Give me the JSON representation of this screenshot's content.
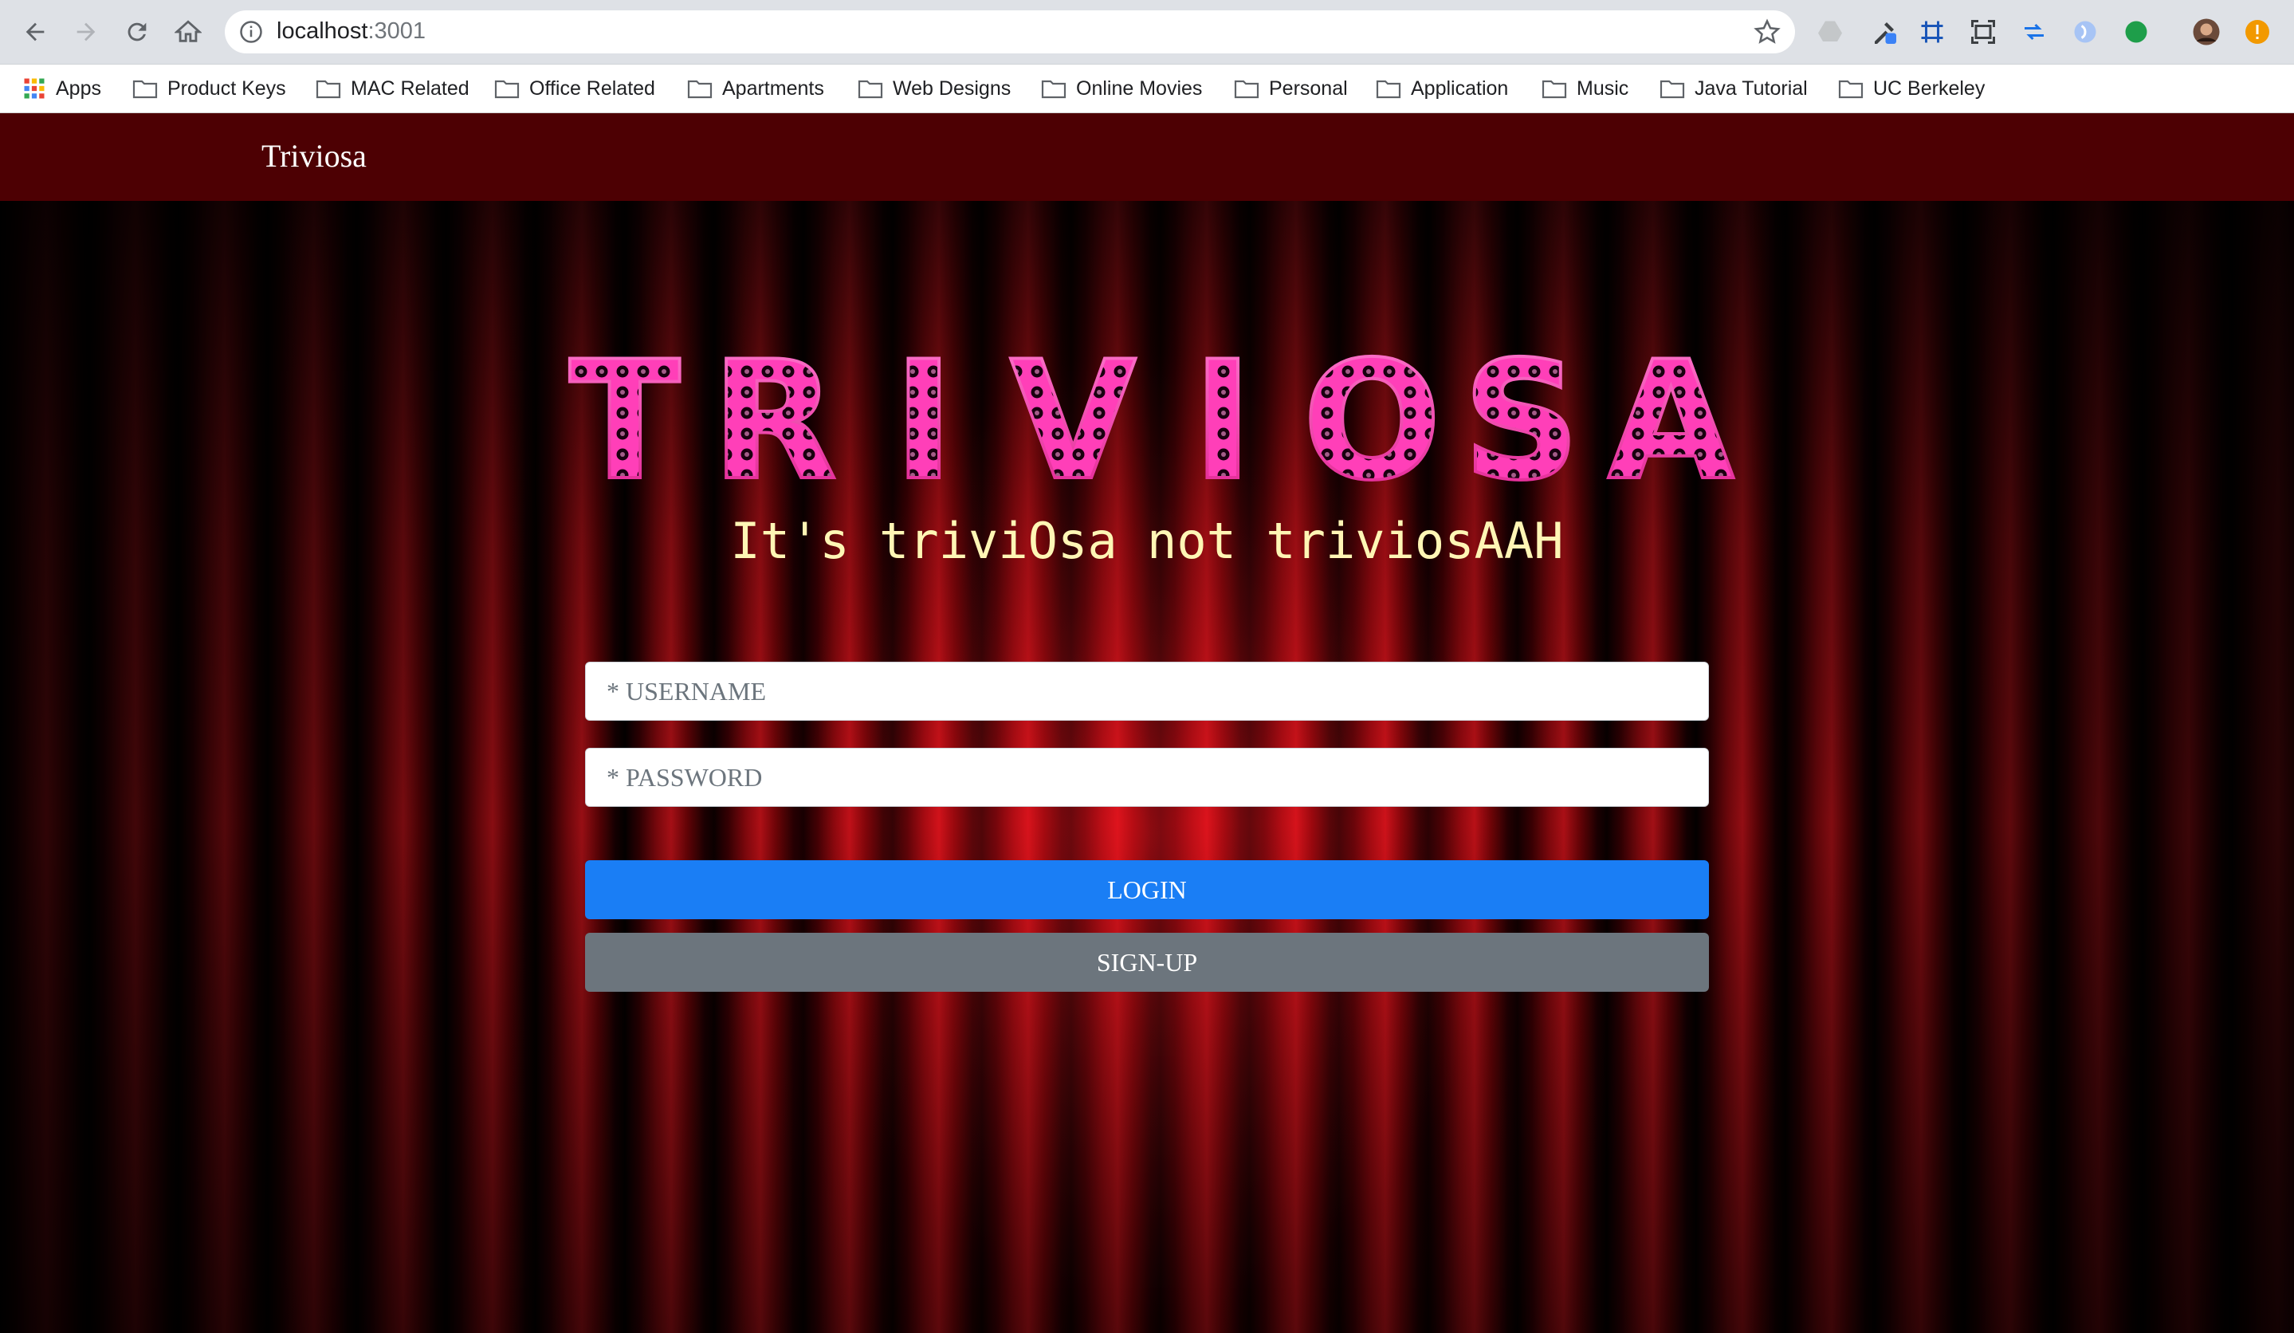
{
  "browser": {
    "url_host": "localhost",
    "url_port": ":3001",
    "bookmarks": [
      {
        "label": "Apps"
      },
      {
        "label": "Product Keys"
      },
      {
        "label": "MAC Related"
      },
      {
        "label": "Office Related"
      },
      {
        "label": "Apartments"
      },
      {
        "label": "Web Designs"
      },
      {
        "label": "Online Movies"
      },
      {
        "label": "Personal"
      },
      {
        "label": "Application"
      },
      {
        "label": "Music"
      },
      {
        "label": "Java Tutorial"
      },
      {
        "label": "UC Berkeley"
      }
    ]
  },
  "navbar": {
    "brand": "Triviosa"
  },
  "hero": {
    "logo_letters": [
      "T",
      "R",
      "I",
      "V",
      "I",
      "O",
      "S",
      "A"
    ],
    "tagline": "It's triviOsa not triviosAAH"
  },
  "form": {
    "username_placeholder": "* USERNAME",
    "password_placeholder": "* PASSWORD",
    "login_label": "LOGIN",
    "signup_label": "SIGN-UP"
  },
  "colors": {
    "navbar": "#4d0003",
    "logo_pink": "#ff3fb8",
    "tagline": "#fff6b5",
    "login": "#1a7ef5",
    "signup": "#6c757d"
  }
}
